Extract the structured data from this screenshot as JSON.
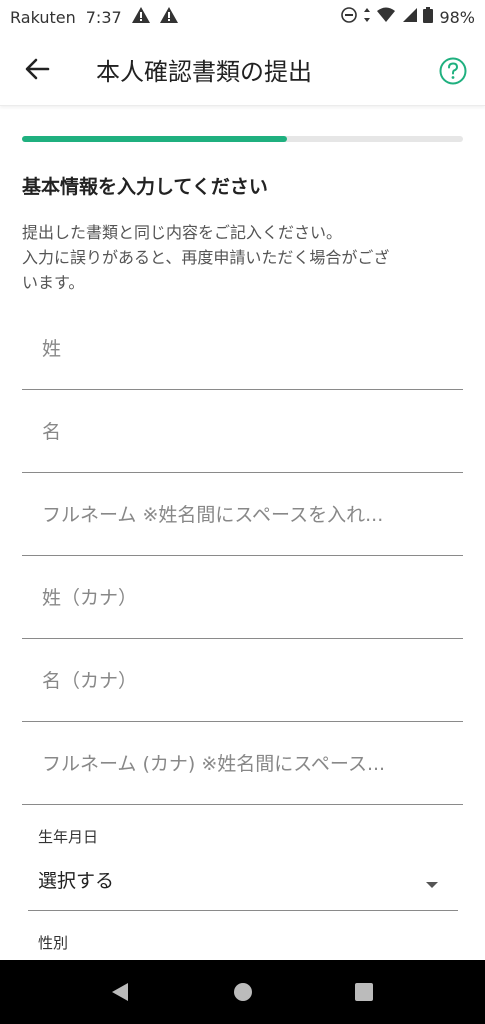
{
  "status_bar": {
    "carrier": "Rakuten",
    "time": "7:37",
    "battery": "98%"
  },
  "header": {
    "title": "本人確認書類の提出"
  },
  "progress": {
    "value": 0.6
  },
  "form": {
    "section_title": "基本情報を入力してください",
    "description_lines": [
      "提出した書類と同じ内容をご記入ください。",
      "入力に誤りがあると、再度申請いただく場合がござ",
      "います。"
    ],
    "fields": [
      {
        "placeholder": "姓"
      },
      {
        "placeholder": "名"
      },
      {
        "placeholder": "フルネーム ※姓名間にスペースを入れ..."
      },
      {
        "placeholder": "姓（カナ）"
      },
      {
        "placeholder": "名（カナ）"
      },
      {
        "placeholder": "フルネーム (カナ) ※姓名間にスペース..."
      }
    ],
    "birthdate": {
      "label": "生年月日",
      "value": "選択する"
    },
    "gender": {
      "label": "性別"
    }
  },
  "colors": {
    "accent": "#1fb07f",
    "track": "#e6e6e6"
  }
}
